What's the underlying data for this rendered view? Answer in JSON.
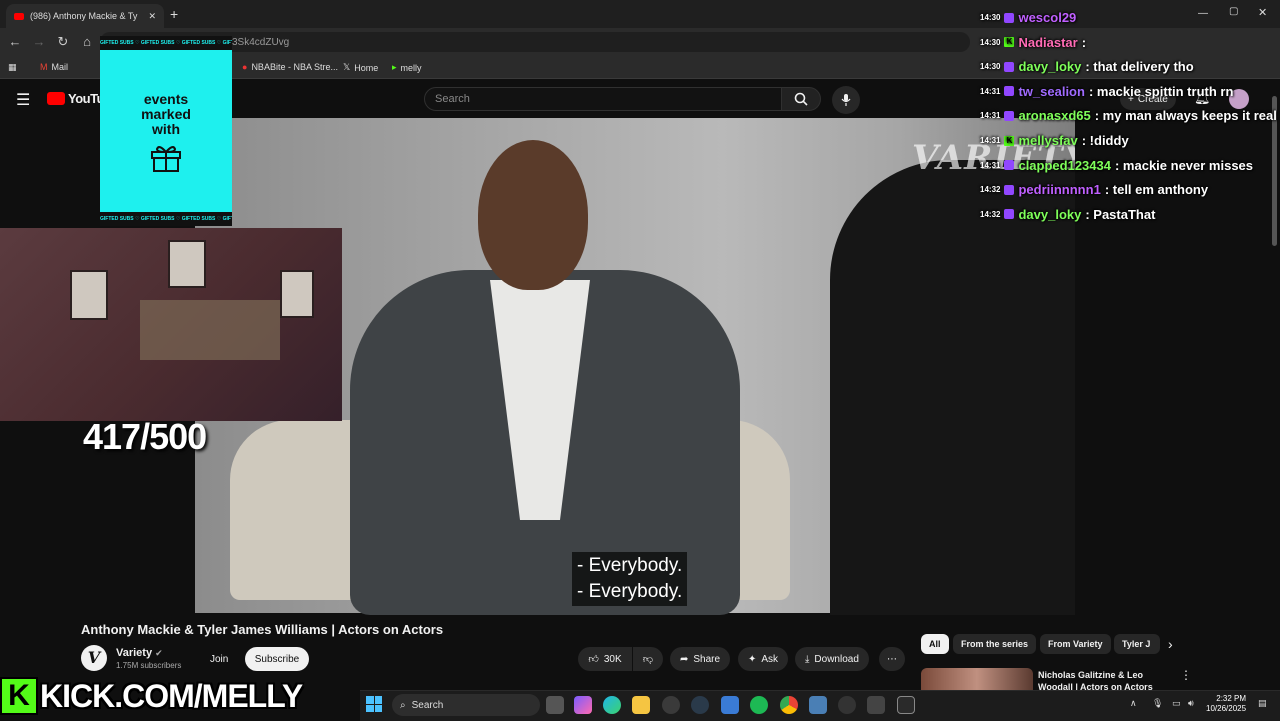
{
  "browser": {
    "tab_title": "(986) Anthony Mackie & Ty",
    "url_fragment": "3Sk4cdZUvg",
    "bookmarks": [
      "Mail",
      "M",
      "NBABite - NBA Stre...",
      "Home",
      "melly"
    ]
  },
  "youtube": {
    "logo": "YouTube",
    "search_placeholder": "Search",
    "create_label": "Create",
    "video_title": "Anthony Mackie & Tyler James Williams | Actors on Actors",
    "channel_name": "Variety",
    "subscribers": "1.75M subscribers",
    "join_label": "Join",
    "subscribe_label": "Subscribe",
    "likes": "30K",
    "share_label": "Share",
    "ask_label": "Ask",
    "download_label": "Download",
    "watermark": "VARIETY",
    "subtitle_line1": "- Everybody.",
    "subtitle_line2": "- Everybody.",
    "chips": [
      "All",
      "From the series",
      "From Variety",
      "Tyler J"
    ],
    "recommended_title": "Nicholas Galitzine & Leo Woodall | Actors on Actors"
  },
  "overlay": {
    "gift_band": "GIFTED SUBS ♡ GIFTED SUBS ♡ GIFTED SUBS ♡ GIFTED SUBS",
    "gift_line1": "events",
    "gift_line2": "marked",
    "gift_line3": "with",
    "sub_goal": "417/500",
    "kick_letter": "K",
    "kick_url": "KICK.COM/MELLY"
  },
  "chat": [
    {
      "time": "14:30",
      "user": "wescol29",
      "message": "",
      "color": "#c060ff",
      "kick": false
    },
    {
      "time": "14:30",
      "user": "Nadiastar",
      "message": ":",
      "color": "#ff6bb5",
      "kick": true
    },
    {
      "time": "14:30",
      "user": "davy_loky",
      "message": ": that delivery tho",
      "color": "#7fff5a",
      "kick": false
    },
    {
      "time": "14:31",
      "user": "tw_sealion",
      "message": ": mackie spittin truth rn",
      "color": "#a06bff",
      "kick": false
    },
    {
      "time": "14:31",
      "user": "aronasxd65",
      "message": ": my man always keeps it real",
      "color": "#7fff5a",
      "kick": false
    },
    {
      "time": "14:31",
      "user": "mellysfav",
      "message": ": !diddy",
      "color": "#7fff5a",
      "kick": true
    },
    {
      "time": "14:31",
      "user": "clapped123434",
      "message": ": mackie never misses",
      "color": "#7fff5a",
      "kick": false
    },
    {
      "time": "14:32",
      "user": "pedriinnnnn1",
      "message": ": tell em anthony",
      "color": "#c060ff",
      "kick": false
    },
    {
      "time": "14:32",
      "user": "davy_loky",
      "message": ": PastaThat",
      "color": "#7fff5a",
      "kick": false
    }
  ],
  "taskbar": {
    "search_label": "Search",
    "time": "2:32 PM",
    "date": "10/26/2025"
  }
}
